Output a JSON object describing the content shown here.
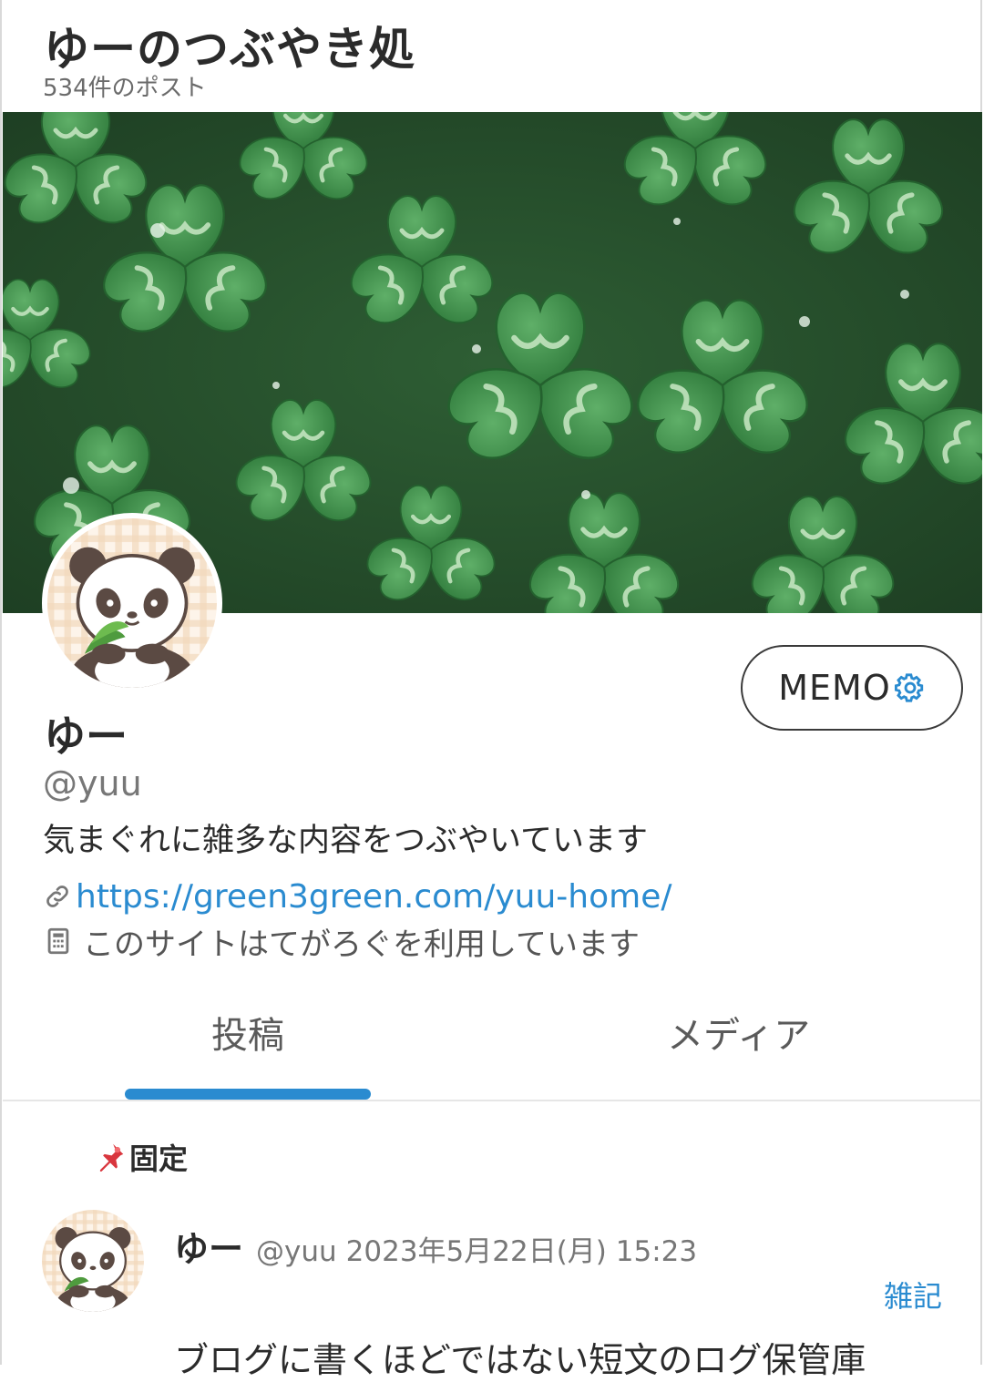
{
  "header": {
    "site_title": "ゆーのつぶやき処",
    "post_count": "534件のポスト"
  },
  "profile": {
    "memo_label": "MEMO",
    "name": "ゆー",
    "handle": "@yuu",
    "bio": "気まぐれに雑多な内容をつぶやいています",
    "url": "https://green3green.com/yuu-home/",
    "site_info": "このサイトはてがろぐを利用しています"
  },
  "tabs": [
    {
      "label": "投稿",
      "active": true
    },
    {
      "label": "メディア",
      "active": false
    }
  ],
  "pinned_post": {
    "pinned_label": "固定",
    "author_name": "ゆー",
    "author_handle": "@yuu",
    "date": "2023年5月22日(月) 15:23",
    "category": "雑記",
    "body": "ブログに書くほどではない短文のログ保管庫"
  },
  "icons": {
    "memo": "gear-icon",
    "url": "link-icon",
    "site_info": "calculator-icon",
    "pinned": "pushpin-icon"
  },
  "colors": {
    "accent": "#2a8bd0",
    "text": "#2b2b2b",
    "muted": "#777777",
    "clover": "#3f8f4a"
  }
}
